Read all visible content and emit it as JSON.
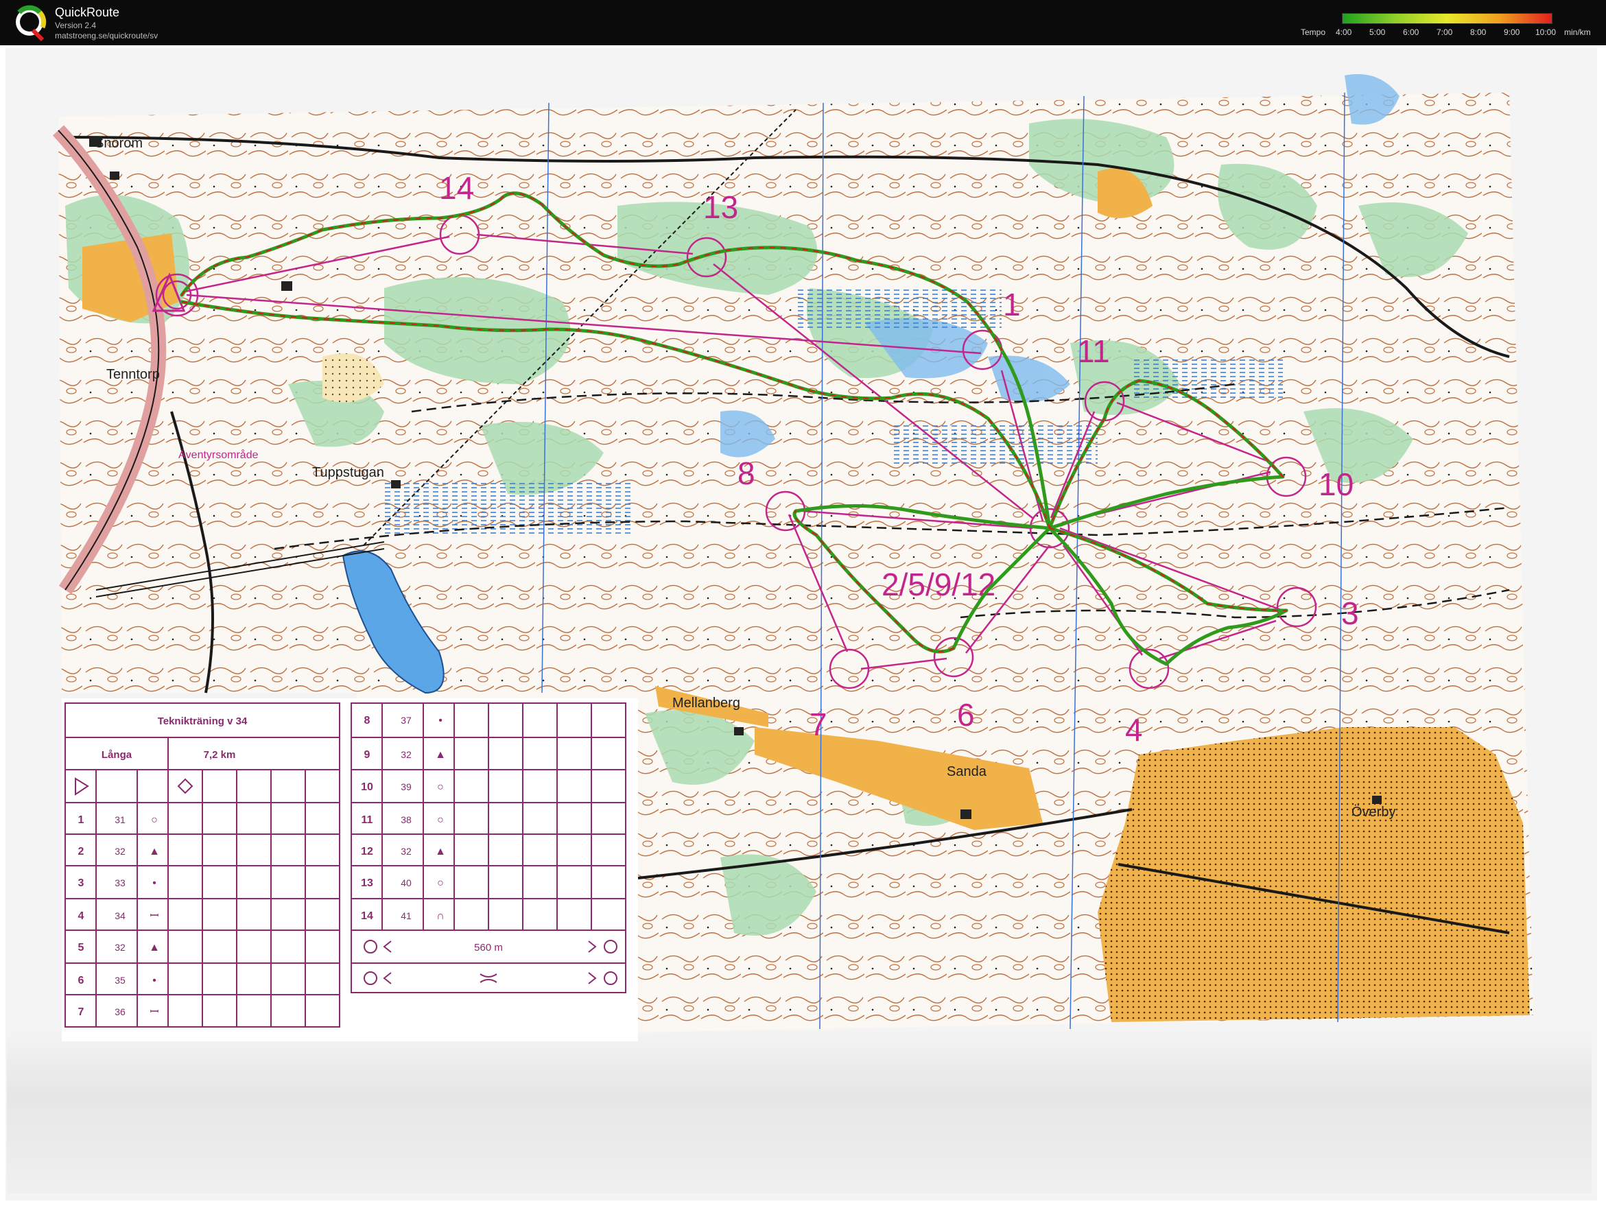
{
  "header": {
    "app_title": "QuickRoute",
    "version": "Version 2.4",
    "url": "matstroeng.se/quickroute/sv",
    "legend_label": "Tempo",
    "legend_ticks": [
      "4:00",
      "5:00",
      "6:00",
      "7:00",
      "8:00",
      "9:00",
      "10:00"
    ],
    "legend_unit": "min/km",
    "legend_colors": [
      "#1fa11f",
      "#8fcf2a",
      "#e8e82a",
      "#f0a020",
      "#e02020"
    ]
  },
  "map": {
    "place_names": [
      "Snörom",
      "Tenntorp",
      "Tuppstugan",
      "Äventyrsområde",
      "Mellanberg",
      "Sanda",
      "Överby"
    ],
    "control_numbers": [
      "14",
      "13",
      "1",
      "11",
      "10",
      "8",
      "2/5/9/12",
      "3",
      "7",
      "6",
      "4"
    ],
    "colors": {
      "course": "#c2268c",
      "route_green": "#2f9a1c",
      "route_red": "#d22020",
      "forest": "#ffffff",
      "open": "#f2b24a",
      "water": "#5aa6e6",
      "green": "#a9dcb2",
      "contour": "#b4683a"
    }
  },
  "description_sheet": {
    "title": "Teknikträning v 34",
    "class": "Långa",
    "length": "7,2 km",
    "left_rows": [
      {
        "num": "1",
        "code": "31",
        "symbol": "○"
      },
      {
        "num": "2",
        "code": "32",
        "symbol": "▲"
      },
      {
        "num": "3",
        "code": "33",
        "symbol": "•"
      },
      {
        "num": "4",
        "code": "34",
        "symbol": "ꟷ"
      },
      {
        "num": "5",
        "code": "32",
        "symbol": "▲"
      },
      {
        "num": "6",
        "code": "35",
        "symbol": "•"
      },
      {
        "num": "7",
        "code": "36",
        "symbol": "ꟷ"
      }
    ],
    "right_rows": [
      {
        "num": "8",
        "code": "37",
        "symbol": "•"
      },
      {
        "num": "9",
        "code": "32",
        "symbol": "▲"
      },
      {
        "num": "10",
        "code": "39",
        "symbol": "○"
      },
      {
        "num": "11",
        "code": "38",
        "symbol": "○"
      },
      {
        "num": "12",
        "code": "32",
        "symbol": "▲"
      },
      {
        "num": "13",
        "code": "40",
        "symbol": "○"
      },
      {
        "num": "14",
        "code": "41",
        "symbol": "∩"
      }
    ],
    "finish_distance": "560 m"
  }
}
